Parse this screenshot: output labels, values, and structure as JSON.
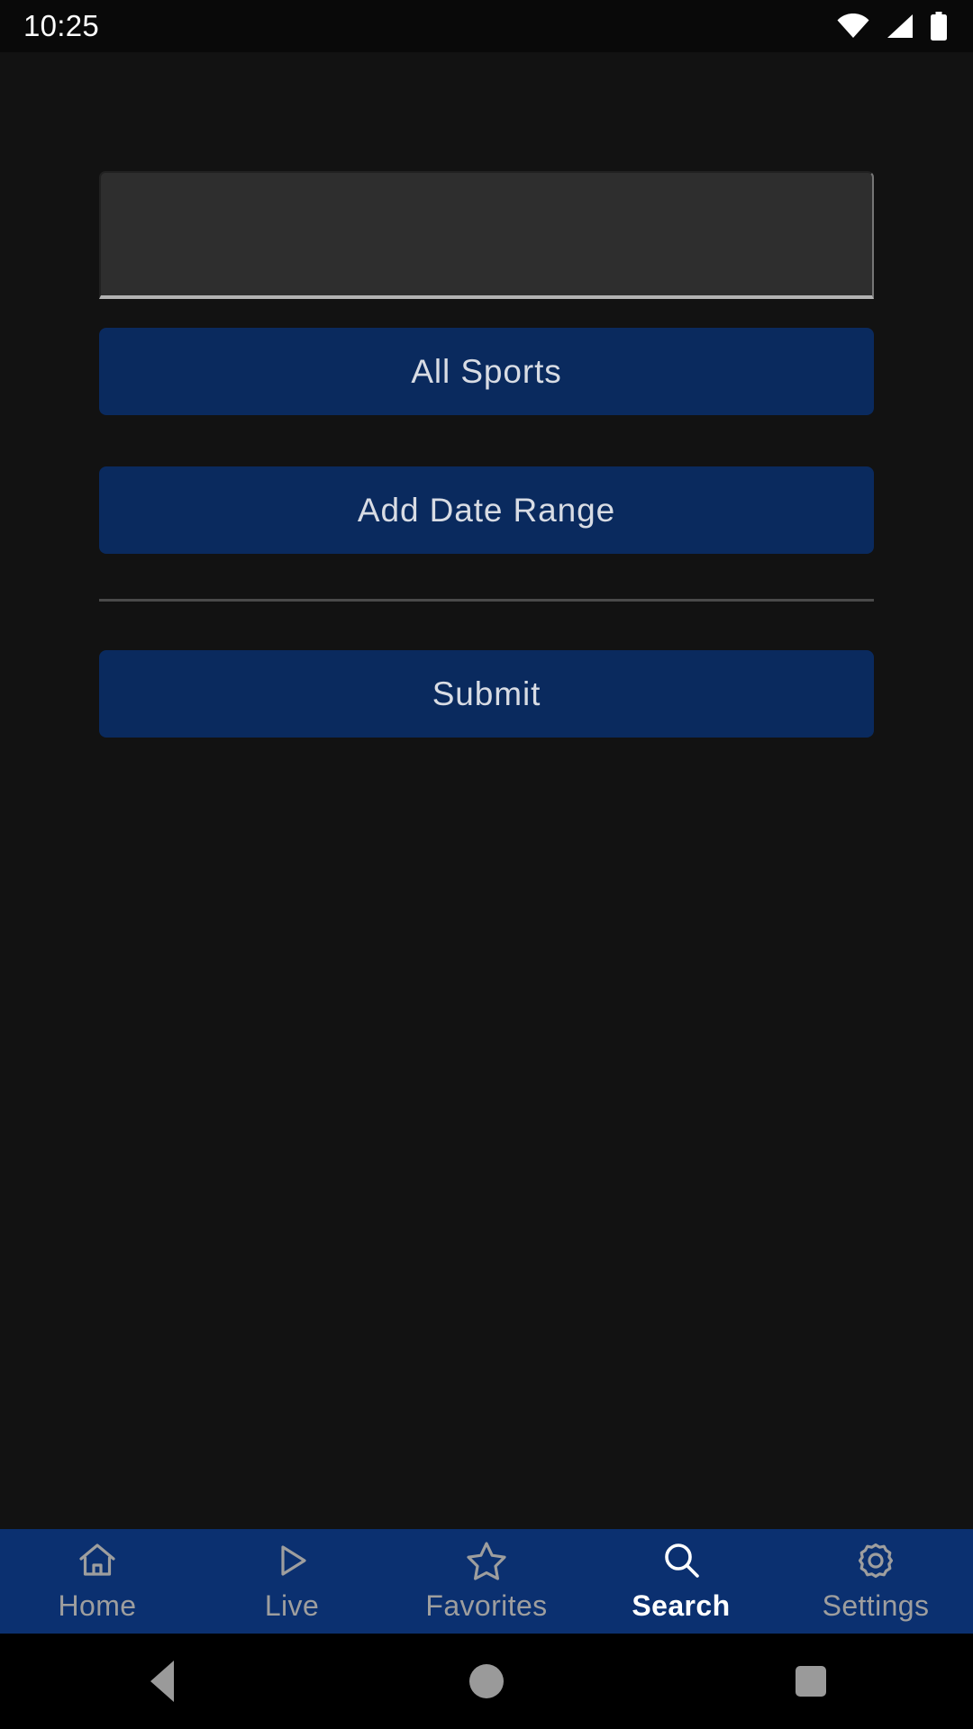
{
  "status_bar": {
    "clock": "10:25",
    "icons": [
      "wifi-icon",
      "cellular-signal-icon",
      "battery-icon"
    ]
  },
  "search_form": {
    "query_input": {
      "value": "",
      "placeholder": ""
    },
    "sport_filter_label": "All Sports",
    "date_range_label": "Add Date Range",
    "submit_label": "Submit"
  },
  "tab_bar": {
    "active": "Search",
    "items": [
      {
        "label": "Home",
        "icon": "home-icon",
        "active": false
      },
      {
        "label": "Live",
        "icon": "play-icon",
        "active": false
      },
      {
        "label": "Favorites",
        "icon": "star-icon",
        "active": false
      },
      {
        "label": "Search",
        "icon": "search-icon",
        "active": true
      },
      {
        "label": "Settings",
        "icon": "gear-icon",
        "active": false
      }
    ]
  },
  "system_nav": {
    "back": "back-button",
    "home": "home-button",
    "recents": "recents-button"
  },
  "colors": {
    "background": "#121212",
    "button": "#0a2a5e",
    "tab_bar": "#0b3070",
    "field": "#2e2e2e",
    "accent_text": "#d8dce4",
    "active_tab_text": "#ffffff",
    "inactive_tab_text": "#9e9e9e"
  }
}
